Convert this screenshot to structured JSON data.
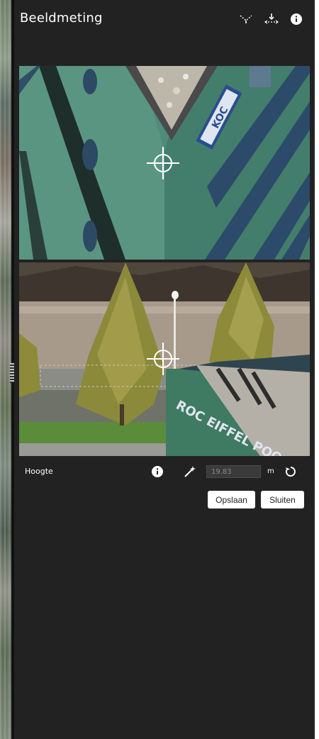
{
  "window": {
    "title": "Beeldmeting"
  },
  "header_icons": [
    "measure-point-icon",
    "height-arrows-icon",
    "info-icon"
  ],
  "toolbar": {
    "label": "Hoogte",
    "icons": [
      "info-icon",
      "magic-wand-icon",
      "reset-icon"
    ],
    "height_value": "19.83",
    "unit": "m"
  },
  "buttons": {
    "save": "Opslaan",
    "close": "Sluiten"
  },
  "photos": {
    "top": {
      "sign_text": "KOC"
    },
    "bottom": {
      "sign_text": "ROC EIFFEL POORT"
    }
  },
  "colors": {
    "panel": "#222222",
    "facade": "#4f8a78",
    "button_bg": "#ffffff"
  }
}
